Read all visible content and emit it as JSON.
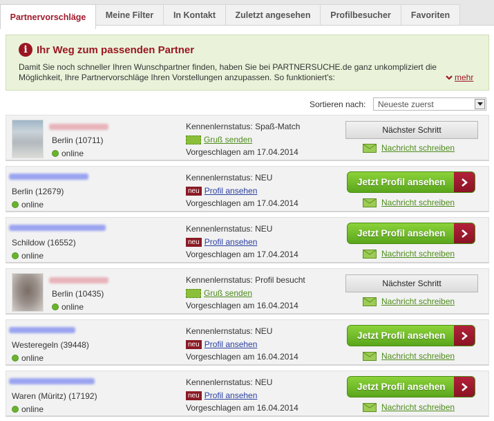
{
  "tabs": [
    {
      "label": "Partnervorschläge",
      "active": true
    },
    {
      "label": "Meine Filter",
      "active": false
    },
    {
      "label": "In Kontakt",
      "active": false
    },
    {
      "label": "Zuletzt angesehen",
      "active": false
    },
    {
      "label": "Profilbesucher",
      "active": false
    },
    {
      "label": "Favoriten",
      "active": false
    }
  ],
  "info": {
    "title": "Ihr Weg zum passenden Partner",
    "text": "Damit Sie noch schneller Ihren Wunschpartner finden, haben Sie bei PARTNERSUCHE.de ganz unkompliziert die Möglichkeit, Ihre Partnervorschläge Ihren Vorstellungen anzupassen. So funktioniert's:",
    "more_label": "mehr"
  },
  "sort": {
    "label": "Sortieren nach:",
    "selected": "Neueste zuerst"
  },
  "colors": {
    "accent_red": "#9b1622",
    "green_link": "#4e8c1b",
    "online_dot": "#6ab42c"
  },
  "results": [
    {
      "has_photo": true,
      "city": "Berlin (10711)",
      "online": "online",
      "status": "Kennenlernstatus: Spaß-Match",
      "action_type": "greet",
      "action_label": "Gruß senden",
      "suggested": "Vorgeschlagen am 17.04.2014",
      "button_type": "next",
      "button_label": "Nächster Schritt",
      "message_label": "Nachricht schreiben"
    },
    {
      "has_photo": false,
      "city": "Berlin (12679)",
      "online": "online",
      "status": "Kennenlernstatus: NEU",
      "action_type": "profile",
      "badge": "neu",
      "action_label": "Profil ansehen",
      "suggested": "Vorgeschlagen am 17.04.2014",
      "button_type": "view",
      "button_label": "Jetzt Profil ansehen",
      "message_label": "Nachricht schreiben"
    },
    {
      "has_photo": false,
      "city": "Schildow (16552)",
      "online": "online",
      "status": "Kennenlernstatus: NEU",
      "action_type": "profile",
      "badge": "neu",
      "action_label": "Profil ansehen",
      "suggested": "Vorgeschlagen am 17.04.2014",
      "button_type": "view",
      "button_label": "Jetzt Profil ansehen",
      "message_label": "Nachricht schreiben"
    },
    {
      "has_photo": true,
      "city": "Berlin (10435)",
      "online": "online",
      "status": "Kennenlernstatus: Profil besucht",
      "action_type": "greet",
      "action_label": "Gruß senden",
      "suggested": "Vorgeschlagen am 16.04.2014",
      "button_type": "next",
      "button_label": "Nächster Schritt",
      "message_label": "Nachricht schreiben"
    },
    {
      "has_photo": false,
      "city": "Westeregeln (39448)",
      "online": "online",
      "status": "Kennenlernstatus: NEU",
      "action_type": "profile",
      "badge": "neu",
      "action_label": "Profil ansehen",
      "suggested": "Vorgeschlagen am 16.04.2014",
      "button_type": "view",
      "button_label": "Jetzt Profil ansehen",
      "message_label": "Nachricht schreiben"
    },
    {
      "has_photo": false,
      "city": "Waren (Müritz) (17192)",
      "online": "online",
      "status": "Kennenlernstatus: NEU",
      "action_type": "profile",
      "badge": "neu",
      "action_label": "Profil ansehen",
      "suggested": "Vorgeschlagen am 16.04.2014",
      "button_type": "view",
      "button_label": "Jetzt Profil ansehen",
      "message_label": "Nachricht schreiben"
    }
  ]
}
